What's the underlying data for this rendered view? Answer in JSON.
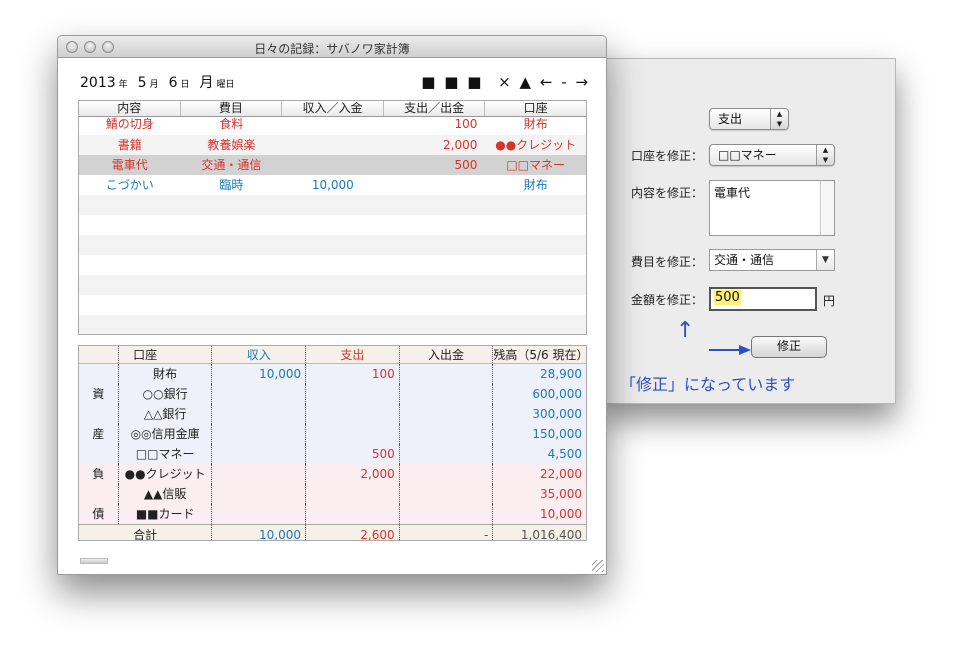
{
  "main_window": {
    "title": "日々の記録：サバノワ家計簿",
    "date": {
      "year": "2013",
      "year_suffix": "年",
      "month": "5",
      "month_suffix": "月",
      "day": "6",
      "day_suffix": "日",
      "weekday": "月",
      "weekday_suffix": "曜日"
    },
    "nav": {
      "sq1": "■",
      "sq2": "■",
      "sq3": "■",
      "delete": "×",
      "up": "▲",
      "prev": "←",
      "mid": "-",
      "next": "→"
    }
  },
  "entries": {
    "columns": [
      "内容",
      "費目",
      "収入／入金",
      "支出／出金",
      "口座"
    ],
    "rows": [
      {
        "content": "鯖の切身",
        "category": "食料",
        "income": "",
        "expense": "100",
        "account": "財布",
        "color": "red"
      },
      {
        "content": "書籍",
        "category": "教養娯楽",
        "income": "",
        "expense": "2,000",
        "account": "●●クレジット",
        "color": "red"
      },
      {
        "content": "電車代",
        "category": "交通・通信",
        "income": "",
        "expense": "500",
        "account": "□□マネー",
        "color": "red",
        "selected": true
      },
      {
        "content": "こづかい",
        "category": "臨時",
        "income": "10,000",
        "expense": "",
        "account": "財布",
        "color": "blue"
      }
    ]
  },
  "balances": {
    "columns": [
      "口座",
      "収入",
      "支出",
      "入出金",
      "残高（5/6 現在）"
    ],
    "rows": [
      {
        "side": "",
        "account": "財布",
        "income": "10,000",
        "expense": "100",
        "transfer": "",
        "balance": "28,900",
        "type": "asset"
      },
      {
        "side": "資",
        "account": "○○銀行",
        "income": "",
        "expense": "",
        "transfer": "",
        "balance": "600,000",
        "type": "asset"
      },
      {
        "side": "",
        "account": "△△銀行",
        "income": "",
        "expense": "",
        "transfer": "",
        "balance": "300,000",
        "type": "asset"
      },
      {
        "side": "産",
        "account": "◎◎信用金庫",
        "income": "",
        "expense": "",
        "transfer": "",
        "balance": "150,000",
        "type": "asset"
      },
      {
        "side": "",
        "account": "□□マネー",
        "income": "",
        "expense": "500",
        "transfer": "",
        "balance": "4,500",
        "type": "asset"
      },
      {
        "side": "負",
        "account": "●●クレジット",
        "income": "",
        "expense": "2,000",
        "transfer": "",
        "balance": "22,000",
        "type": "liab"
      },
      {
        "side": "",
        "account": "▲▲信販",
        "income": "",
        "expense": "",
        "transfer": "",
        "balance": "35,000",
        "type": "liab"
      },
      {
        "side": "債",
        "account": "■■カード",
        "income": "",
        "expense": "",
        "transfer": "",
        "balance": "10,000",
        "type": "liab"
      }
    ],
    "total": {
      "label": "合計",
      "income": "10,000",
      "expense": "2,600",
      "transfer": "-",
      "balance": "1,016,400"
    }
  },
  "edit_panel": {
    "type_select": "支出",
    "account_label": "口座を修正：",
    "account_value": "□□マネー",
    "content_label": "内容を修正：",
    "content_value": "電車代",
    "category_label": "費目を修正：",
    "category_value": "交通・通信",
    "amount_label": "金額を修正：",
    "amount_value": "500",
    "currency": "円",
    "submit_label": "修正",
    "note": "「修正」になっています",
    "up_arrow": "↑"
  }
}
